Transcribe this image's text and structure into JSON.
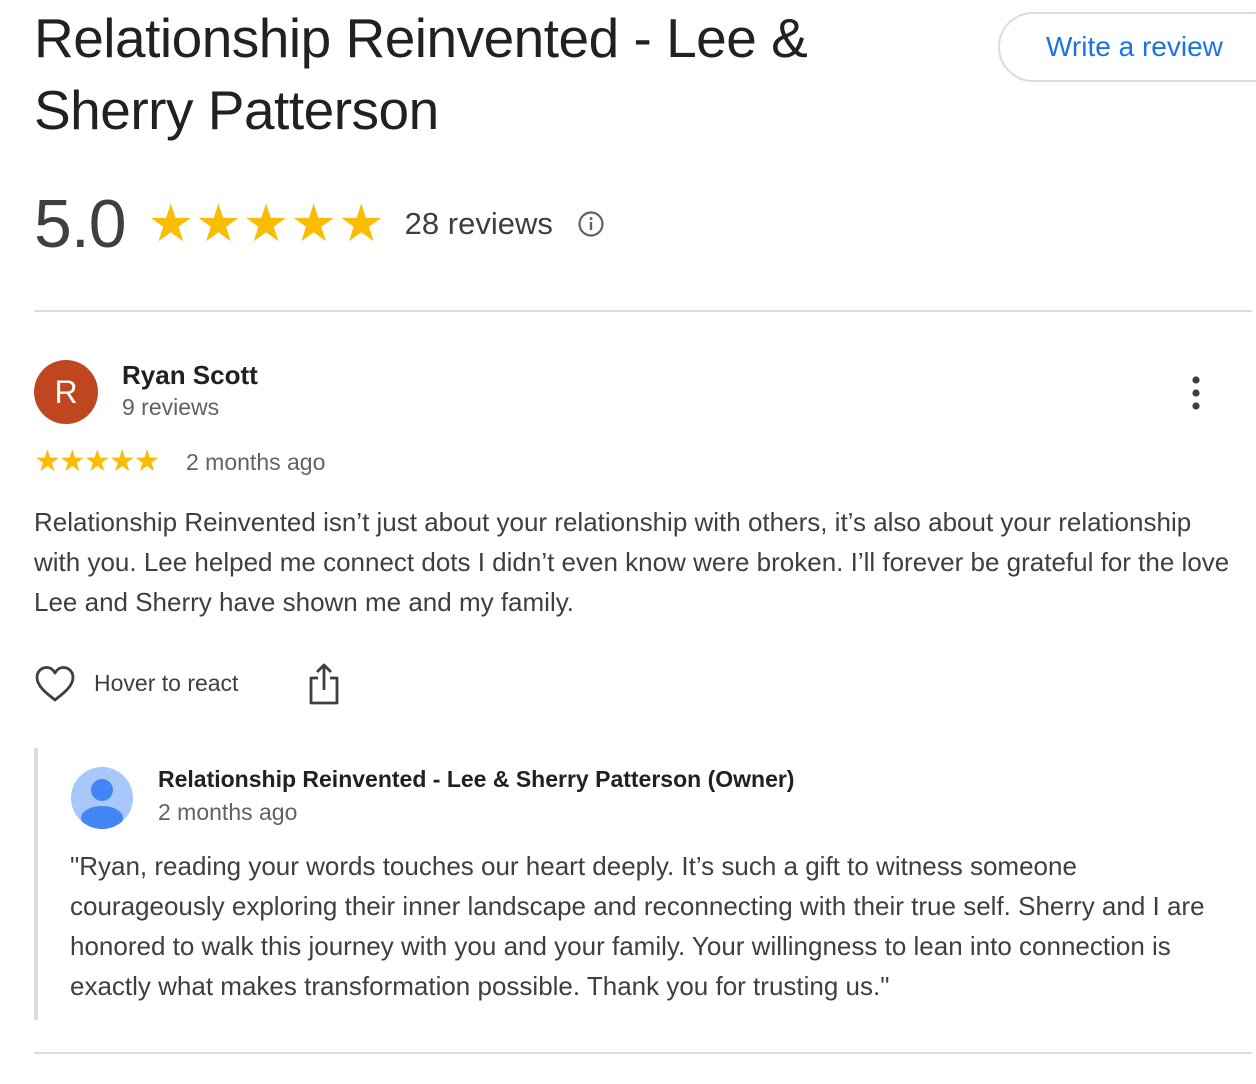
{
  "header": {
    "title": "Relationship Reinvented - Lee & Sherry Patterson",
    "write_review_label": "Write a review"
  },
  "summary": {
    "rating": "5.0",
    "stars": 5,
    "review_count": "28 reviews",
    "star_glyph": "★",
    "star_color": "#fbbc04"
  },
  "review": {
    "avatar_letter": "R",
    "avatar_color": "#c0461f",
    "name": "Ryan Scott",
    "meta": "9 reviews",
    "stars": 5,
    "date": "2 months ago",
    "text": "Relationship Reinvented isn’t just about your relationship with others, it’s also about your relationship with you. Lee helped me connect dots I didn’t even know were broken. I’ll forever be grateful for the love Lee and Sherry have shown me and my family.",
    "react_label": "Hover to react"
  },
  "owner_reply": {
    "name": "Relationship Reinvented - Lee & Sherry Patterson (Owner)",
    "date": "2 months ago",
    "text": "\"Ryan, reading your words touches our heart deeply. It’s such a gift to witness someone courageously exploring their inner landscape and reconnecting with their true self. Sherry and I are honored to walk this journey with you and your family. Your willingness to lean into connection is exactly what makes transformation possible. Thank you for trusting us.\""
  },
  "icons": {
    "info": "info-icon",
    "more": "more-vert-icon",
    "react": "heart-icon",
    "share": "share-icon",
    "owner_avatar": "person-avatar-icon"
  },
  "colors": {
    "accent_blue": "#1a73e8",
    "owner_avatar_bg": "#a8c7fa",
    "owner_avatar_fg": "#4285f4"
  }
}
